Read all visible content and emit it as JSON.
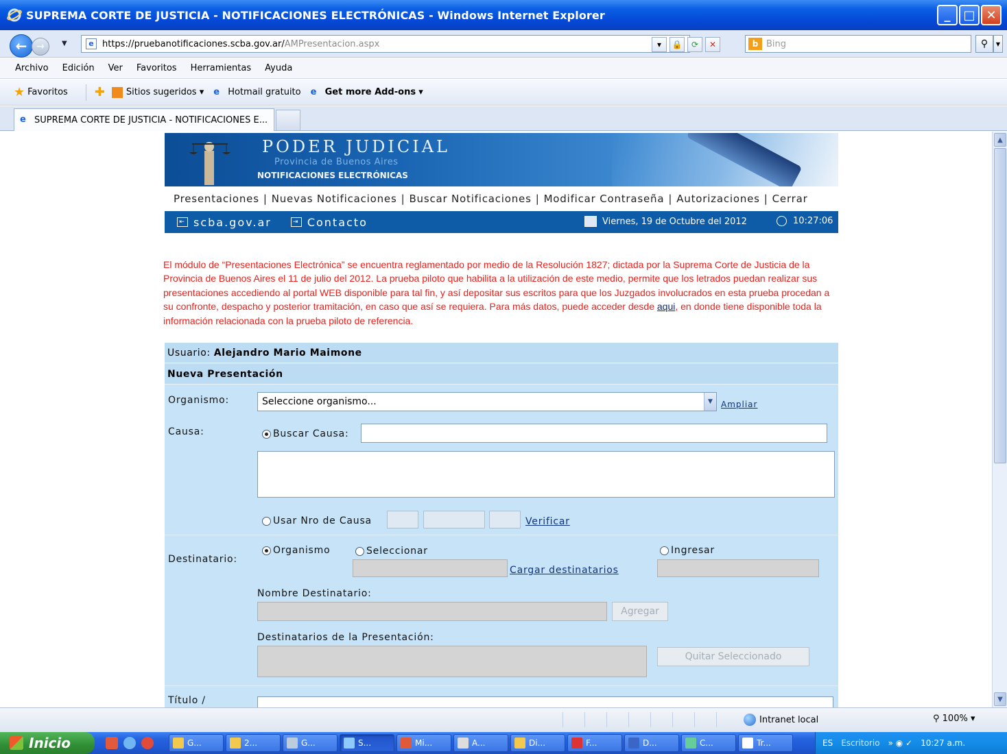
{
  "window": {
    "title": "SUPREMA CORTE DE JUSTICIA - NOTIFICACIONES ELECTRÓNICAS - Windows Internet Explorer"
  },
  "address": {
    "url_host": "https://pruebanotificaciones.scba.gov.ar/",
    "url_path": "AMPresentacion.aspx",
    "search_placeholder": "Bing"
  },
  "menu": [
    "Archivo",
    "Edición",
    "Ver",
    "Favoritos",
    "Herramientas",
    "Ayuda"
  ],
  "favbar": {
    "favoritos": "Favoritos",
    "sitios": "Sitios sugeridos",
    "hotmail": "Hotmail gratuito",
    "addons": "Get more Add-ons"
  },
  "tab": {
    "label": "SUPREMA CORTE DE JUSTICIA - NOTIFICACIONES E..."
  },
  "banner": {
    "title": "PODER JUDICIAL",
    "sub": "Provincia de Buenos Aires",
    "sub2": "NOTIFICACIONES ELECTRÓNICAS"
  },
  "topnav": [
    "Presentaciones",
    "Nuevas Notificaciones",
    "Buscar Notificaciones",
    "Modificar Contraseña",
    "Autorizaciones",
    "Cerrar"
  ],
  "bluebar": {
    "link1": "scba.gov.ar",
    "link2": "Contacto",
    "date": "Viernes, 19 de Octubre del 2012",
    "time": "10:27:06"
  },
  "notice": {
    "part1": "El módulo de “Presentaciones Electrónica” se encuentra reglamentado por medio de la Resolución 1827; dictada por la Suprema Corte de Justicia de la Provincia de Buenos Aires el 11 de julio del 2012. La prueba piloto que habilita a la utilización de este medio, permite que los letrados puedan realizar sus presentaciones accediendo al portal WEB disponible para tal fin, y así depositar sus escritos para que los Juzgados involucrados en esta prueba procedan a su confronte, despacho y posterior tramitación, en caso que así se requiera. Para más datos, puede acceder desde ",
    "link": "aqui",
    "part2": ", en donde tiene disponible toda la información relacionada con la prueba piloto de referencia."
  },
  "form": {
    "usuario_label": "Usuario:",
    "usuario_name": "Alejandro Mario Maimone",
    "section_title": "Nueva Presentación",
    "organismo_label": "Organismo:",
    "organismo_value": "Seleccione organismo...",
    "ampliar": "Ampliar",
    "causa_label": "Causa:",
    "buscar_causa": "Buscar Causa:",
    "usar_nro": "Usar Nro de Causa",
    "verificar": "Verificar",
    "destinatario_label": "Destinatario:",
    "opt_organismo": "Organismo",
    "opt_seleccionar": "Seleccionar",
    "opt_ingresar": "Ingresar",
    "cargar": "Cargar destinatarios",
    "nombre_dest": "Nombre Destinatario:",
    "agregar": "Agregar",
    "dest_presentacion": "Destinatarios de la Presentación:",
    "quitar": "Quitar Seleccionado",
    "titulo_label": "Título /"
  },
  "status": {
    "zone": "Intranet local",
    "zoom": "100%"
  },
  "taskbar": {
    "start": "Inicio",
    "buttons": [
      "G...",
      "2...",
      "G...",
      "S...",
      "Mi...",
      "A...",
      "Di...",
      "F...",
      "D...",
      "C...",
      "Tr..."
    ],
    "lang": "ES",
    "desktop": "Escritorio",
    "clock": "10:27 a.m."
  }
}
